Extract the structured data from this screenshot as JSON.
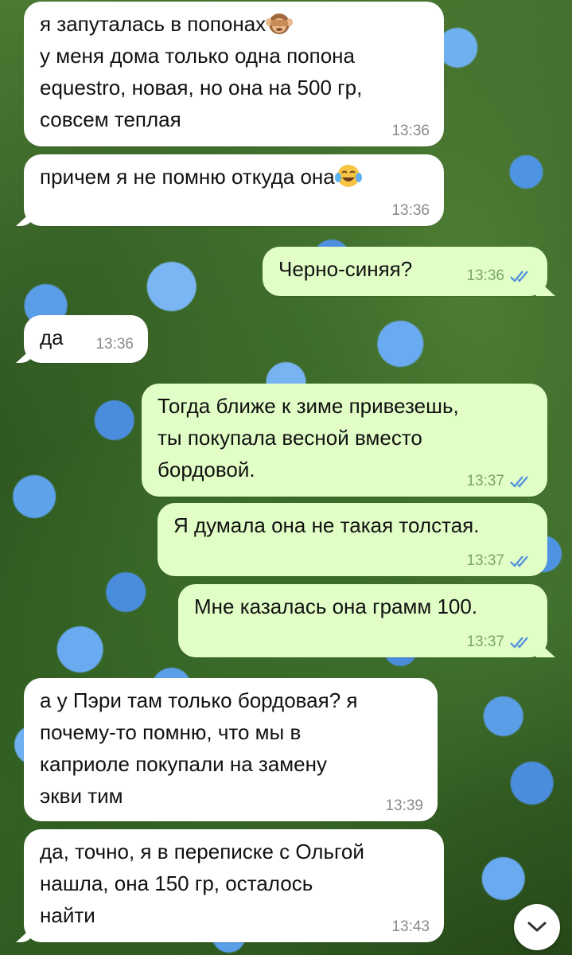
{
  "chat": {
    "messages": [
      {
        "direction": "in",
        "text": "я запуталась в попонах",
        "text2": "у меня дома только одна попона\nequestro, новая, но она на 500 гр,\nсовсем теплая",
        "emoji": "see-no-evil-monkey",
        "time": "13:36"
      },
      {
        "direction": "in",
        "text": "причем я не помню откуда она",
        "emoji": "face-with-tears-of-joy",
        "time": "13:36"
      },
      {
        "direction": "out",
        "text": "Черно-синяя?",
        "time": "13:36",
        "status": "read"
      },
      {
        "direction": "in",
        "text": "да",
        "time": "13:36"
      },
      {
        "direction": "out",
        "text": "Тогда ближе к зиме привезешь,\nты покупала весной вместо\nбордовой.",
        "time": "13:37",
        "status": "read"
      },
      {
        "direction": "out",
        "text": "Я думала она не такая толстая.",
        "time": "13:37",
        "status": "read"
      },
      {
        "direction": "out",
        "text": "Мне казалась она грамм 100.",
        "time": "13:37",
        "status": "read"
      },
      {
        "direction": "in",
        "text": "а у Пэри там только бордовая? я\nпочему-то помню, что мы в\nкаприоле покупали на замену\nэкви тим",
        "time": "13:39"
      },
      {
        "direction": "in",
        "text": "да, точно, я в переписке с Ольгой\nнашла, она 150 гр,  осталось\nнайти",
        "time": "13:43"
      }
    ]
  },
  "colors": {
    "incoming_bubble": "#ffffff",
    "outgoing_bubble": "#e1fec6",
    "read_ticks": "#4c8fdc"
  },
  "icons": {
    "scroll_down": "chevron-down-icon",
    "read_status": "double-check-icon"
  }
}
